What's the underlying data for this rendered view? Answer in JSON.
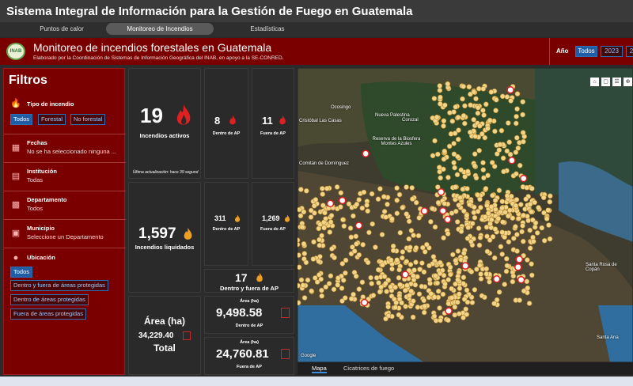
{
  "app": {
    "title": "Sistema Integral de Información para la Gestión de Fuego en Guatemala"
  },
  "tabs": [
    {
      "label": "Puntos de calor"
    },
    {
      "label": "Monitoreo de Incendios"
    },
    {
      "label": "Estadísticas"
    }
  ],
  "header": {
    "logo_text": "INAB",
    "title": "Monitoreo de incendios forestales en Guatemala",
    "subtitle": "Elaborado por la Coordinación de Sistemas de Información Geográfica del INAB, en apoyo a la SE-CONRED."
  },
  "year_filter": {
    "label": "Año",
    "options": [
      "Todos",
      "2023",
      "2"
    ],
    "selected": "Todos"
  },
  "filters": {
    "title": "Filtros",
    "tipo": {
      "label": "Tipo de incendio",
      "options": [
        "Todos",
        "Forestal",
        "No forestal"
      ],
      "selected": "Todos"
    },
    "fechas": {
      "label": "Fechas",
      "value": "No se ha seleccionado ninguna ..."
    },
    "institucion": {
      "label": "Institución",
      "value": "Todas"
    },
    "departamento": {
      "label": "Departamento",
      "value": "Todos"
    },
    "municipio": {
      "label": "Municipio",
      "value": "Seleccione un Departamento"
    },
    "ubicacion": {
      "label": "Ubicación",
      "options": [
        "Todos",
        "Dentro y fuera de áreas protegidas",
        "Dentro de áreas protegidas",
        "Fuera de áreas protegidas"
      ],
      "selected": "Todos"
    }
  },
  "stats": {
    "activos": {
      "value": "19",
      "label": "Incendios activos",
      "updated": "Última actualización: hace 39 segund"
    },
    "activos_dentro": {
      "value": "8",
      "label": "Dentro de AP"
    },
    "activos_fuera": {
      "value": "11",
      "label": "Fuera de AP"
    },
    "liquidados": {
      "value": "1,597",
      "label": "Incendios liquidados"
    },
    "liquidados_dentro": {
      "value": "311",
      "label": "Dentro de AP"
    },
    "liquidados_fuera": {
      "value": "1,269",
      "label": "Fuera de AP"
    },
    "dentro_fuera": {
      "value": "17",
      "label": "Dentro y fuera de AP"
    },
    "area_total": {
      "title": "Área (ha)",
      "value": "34,229.40",
      "label": "Total"
    },
    "area_dentro": {
      "title": "Área (ha)",
      "value": "9,498.58",
      "label": "Dentro de AP"
    },
    "area_fuera": {
      "title": "Área (ha)",
      "value": "24,760.81",
      "label": "Fuera de AP"
    }
  },
  "map": {
    "labels": [
      "Ocosingo",
      "Nueva Palestina",
      "Corozal",
      "Cristóbal Las Casas",
      "Reserva de la Biosfera Montes Azules",
      "Comitán de Domínguez",
      "Santa Rosa de Copán",
      "Santa Ana",
      "Google"
    ],
    "tabs": [
      "Mapa",
      "Cicatrices de fuego"
    ],
    "selected_tab": "Mapa"
  },
  "colors": {
    "header": "#7a0000",
    "panel": "#2a2a2a",
    "accent_blue": "#1f5ea6",
    "flame_red": "#e02020",
    "flame_orange": "#f0a020"
  }
}
